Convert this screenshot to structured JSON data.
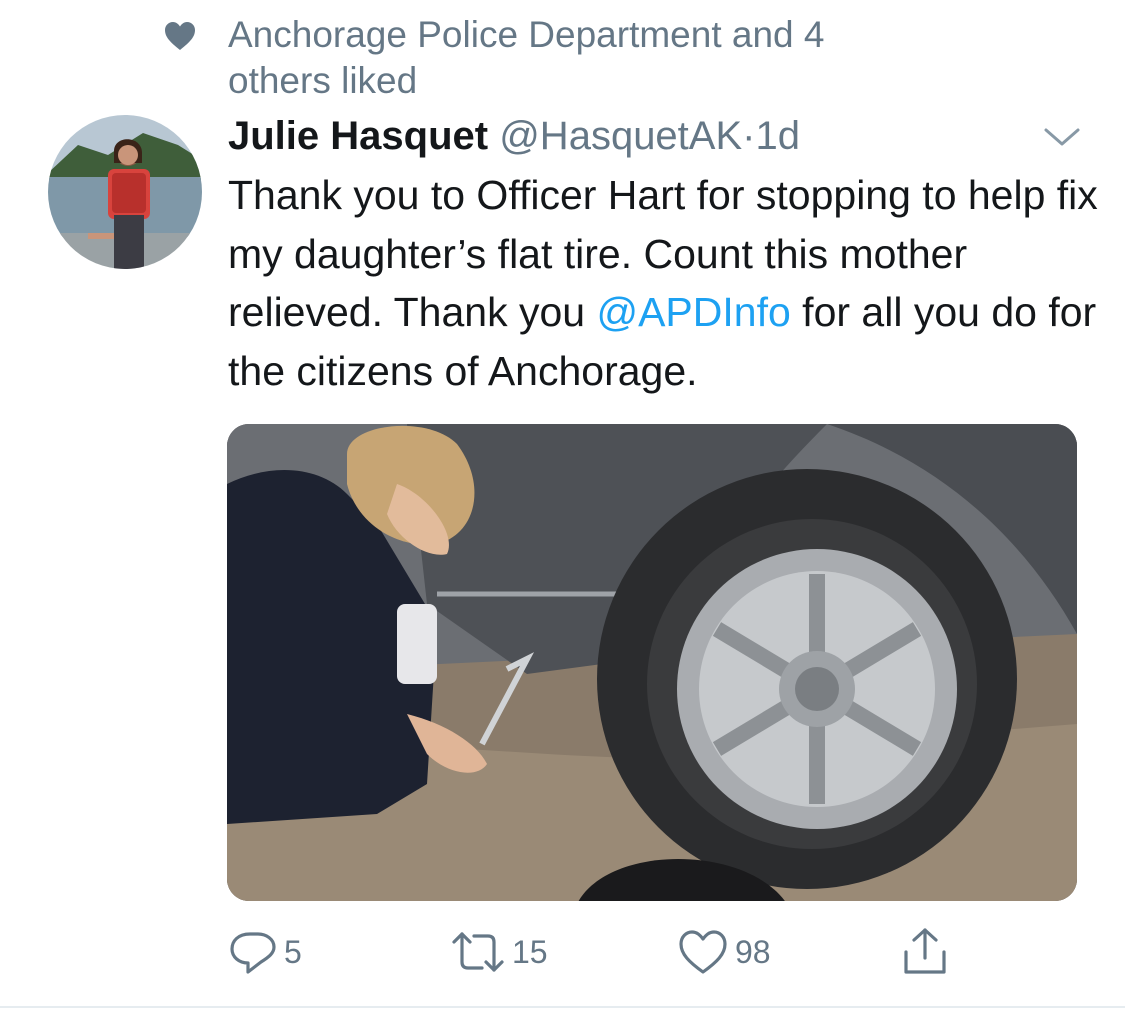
{
  "social_context": {
    "icon": "heart-icon",
    "text": "Anchorage Police Department and 4 others liked"
  },
  "tweet": {
    "author": {
      "name": "Julie Hasquet",
      "handle": "@HasquetAK",
      "separator": "·",
      "time": "1d",
      "avatar": "avatar-photo"
    },
    "menu_icon": "chevron-down-icon",
    "text_before_mention": "Thank you to Officer Hart for stopping to help fix my daughter’s flat tire. Count this mother relieved. Thank you ",
    "mention": "@APDInfo",
    "text_after_mention": " for all you do for the citizens of Anchorage.",
    "media": "photo of police officer changing a flat tire",
    "actions": {
      "reply": {
        "icon": "reply-icon",
        "count": "5"
      },
      "retweet": {
        "icon": "retweet-icon",
        "count": "15"
      },
      "like": {
        "icon": "like-icon",
        "count": "98"
      },
      "share": {
        "icon": "share-icon"
      }
    }
  },
  "colors": {
    "text_primary": "#14171a",
    "text_secondary": "#657786",
    "mention": "#1da1f2",
    "divider": "#e6ecf0"
  }
}
